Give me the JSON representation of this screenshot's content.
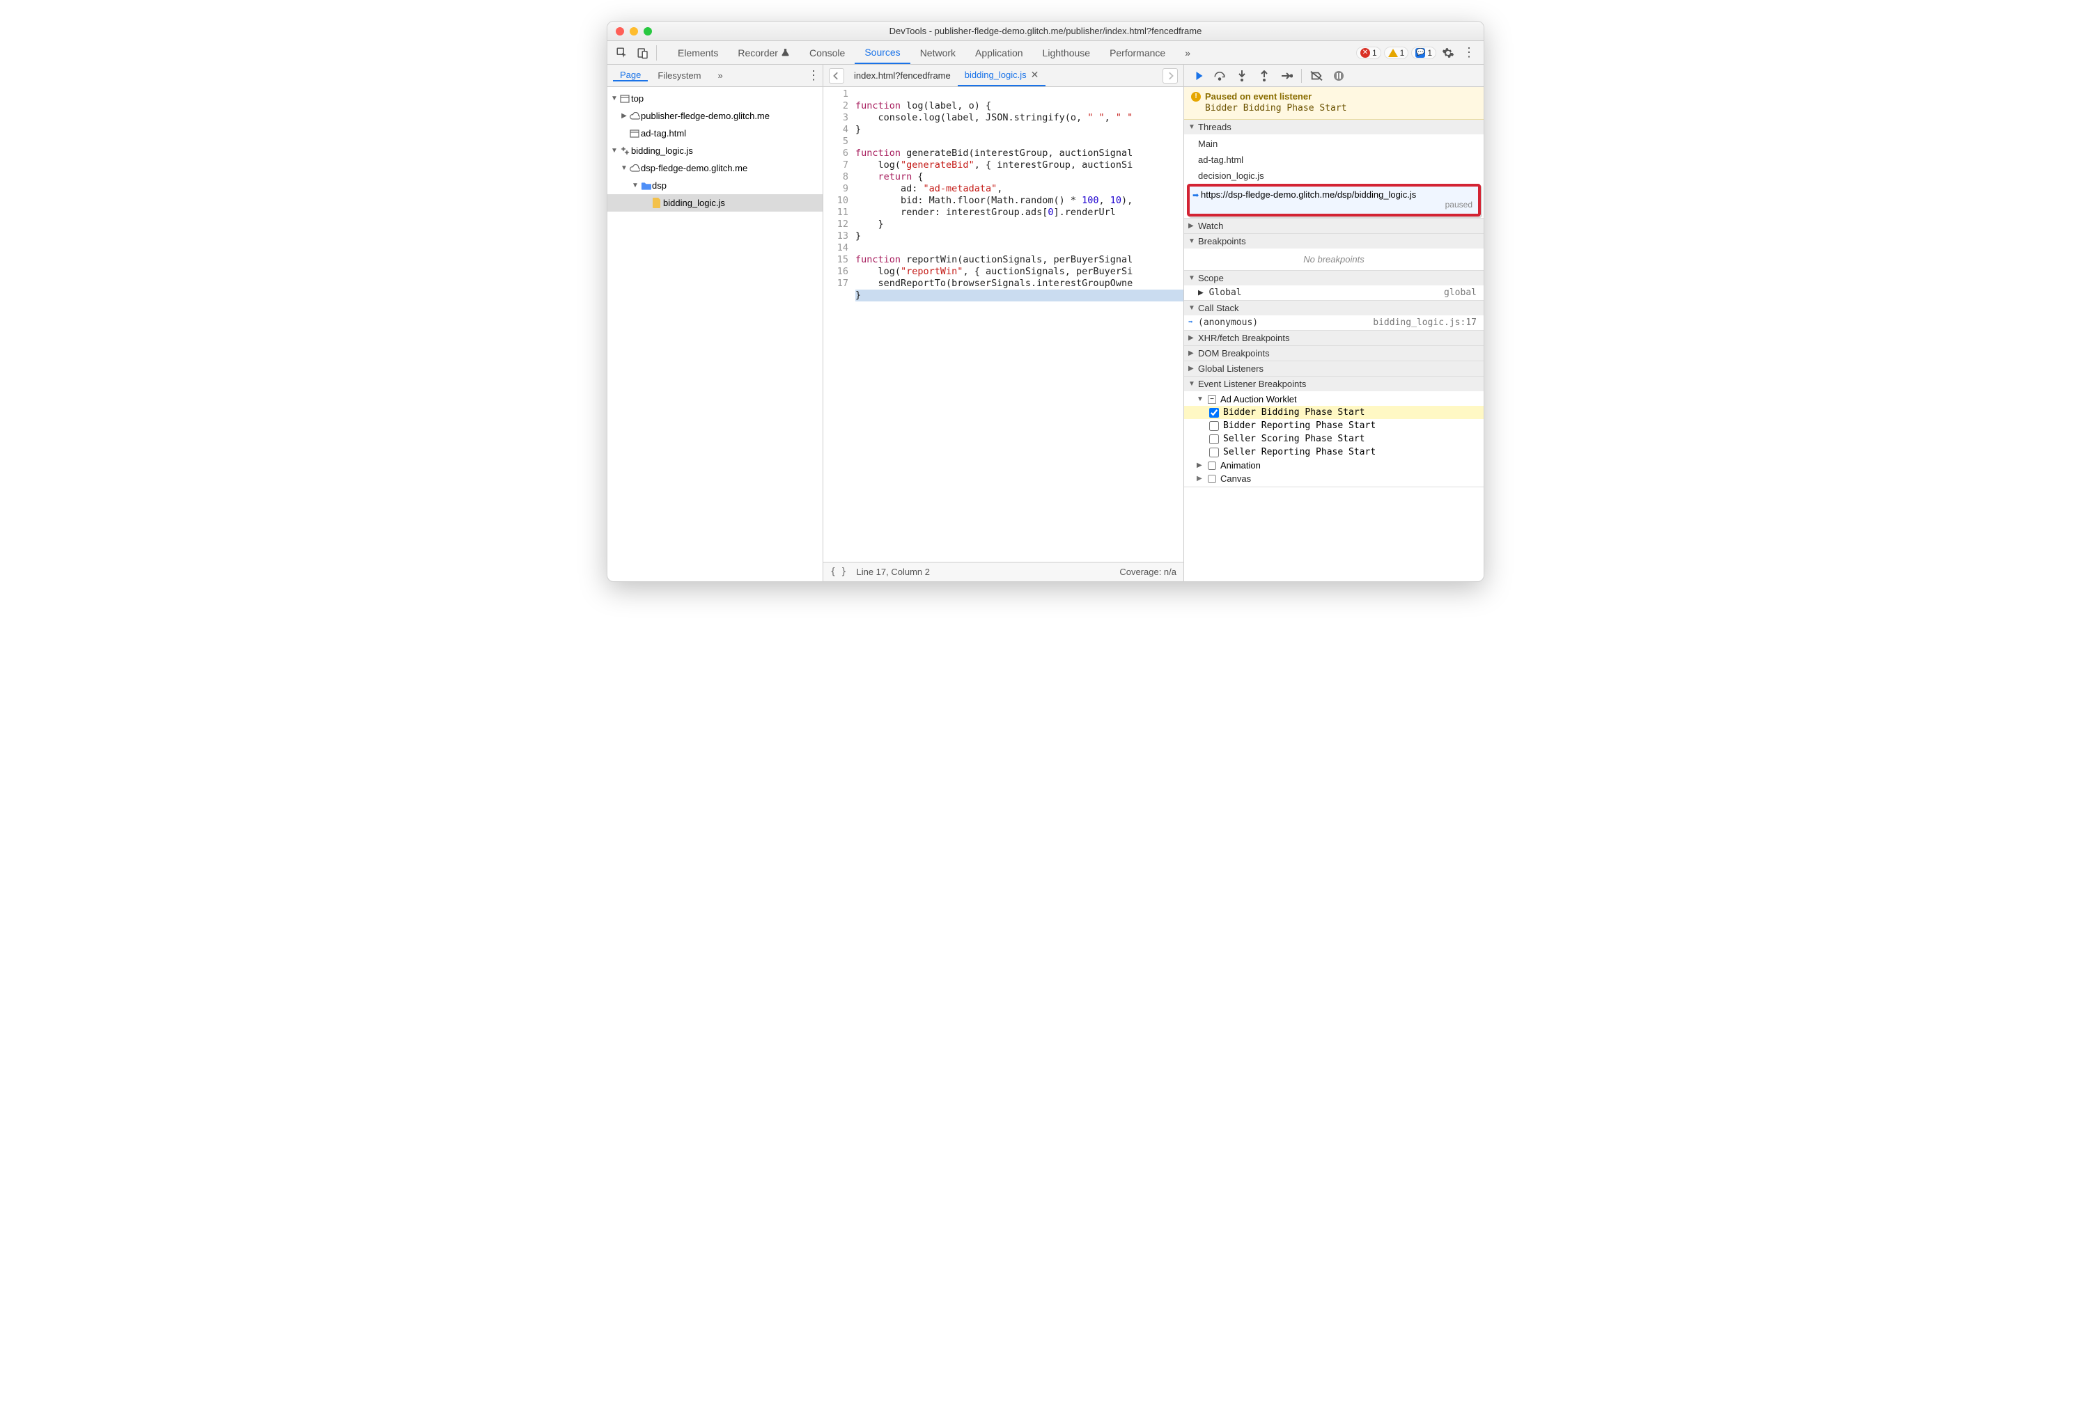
{
  "window": {
    "title": "DevTools - publisher-fledge-demo.glitch.me/publisher/index.html?fencedframe"
  },
  "panelTabs": {
    "items": [
      "Elements",
      "Recorder",
      "Console",
      "Sources",
      "Network",
      "Application",
      "Lighthouse",
      "Performance"
    ],
    "active": "Sources",
    "more": "»"
  },
  "badges": {
    "errors": "1",
    "warnings": "1",
    "issues": "1"
  },
  "sourcesSubTabs": {
    "items": [
      "Page",
      "Filesystem"
    ],
    "active": "Page",
    "more": "»"
  },
  "editor": {
    "openTabs": [
      {
        "label": "index.html?fencedframe"
      },
      {
        "label": "bidding_logic.js"
      }
    ],
    "activeTab": 1,
    "cursor": "Line 17, Column 2",
    "coverage": "Coverage: n/a",
    "lineCount": 17,
    "code": {
      "l1a": "function",
      "l1b": " log(label, o) {",
      "l2a": "    console.log(label, JSON.stringify(o, ",
      "l2s1": "\" \"",
      "l2b": ", ",
      "l2s2": "\" \"",
      "l3": "}",
      "l4": "",
      "l5a": "function",
      "l5b": " generateBid(interestGroup, auctionSignal",
      "l6a": "    log(",
      "l6s": "\"generateBid\"",
      "l6b": ", { interestGroup, auctionSi",
      "l7a": "    ",
      "l7k": "return",
      "l7b": " {",
      "l8a": "        ad: ",
      "l8s": "\"ad-metadata\"",
      "l8b": ",",
      "l9a": "        bid: Math.floor(Math.random() * ",
      "l9n1": "100",
      "l9b": ", ",
      "l9n2": "10",
      "l9c": "),",
      "l10a": "        render: interestGroup.ads[",
      "l10n": "0",
      "l10b": "].renderUrl",
      "l11": "    }",
      "l12": "}",
      "l13": "",
      "l14a": "function",
      "l14b": " reportWin(auctionSignals, perBuyerSignal",
      "l15a": "    log(",
      "l15s": "\"reportWin\"",
      "l15b": ", { auctionSignals, perBuyerSi",
      "l16": "    sendReportTo(browserSignals.interestGroupOwne",
      "l17": "}"
    }
  },
  "fileTree": {
    "items": [
      {
        "indent": 0,
        "toggle": "▼",
        "icon": "frame",
        "label": "top"
      },
      {
        "indent": 1,
        "toggle": "▶",
        "icon": "cloud",
        "label": "publisher-fledge-demo.glitch.me"
      },
      {
        "indent": 1,
        "toggle": "",
        "icon": "frame",
        "label": "ad-tag.html"
      },
      {
        "indent": 0,
        "toggle": "▼",
        "icon": "gears",
        "label": "bidding_logic.js"
      },
      {
        "indent": 1,
        "toggle": "▼",
        "icon": "cloud",
        "label": "dsp-fledge-demo.glitch.me"
      },
      {
        "indent": 2,
        "toggle": "▼",
        "icon": "folder",
        "label": "dsp"
      },
      {
        "indent": 3,
        "toggle": "",
        "icon": "jsfile",
        "label": "bidding_logic.js",
        "selected": true
      }
    ]
  },
  "pauseBanner": {
    "title": "Paused on event listener",
    "detail": "Bidder Bidding Phase Start"
  },
  "threads": {
    "title": "Threads",
    "items": [
      "Main",
      "ad-tag.html",
      "decision_logic.js"
    ],
    "highlighted": {
      "label": "https://dsp-fledge-demo.glitch.me/dsp/bidding_logic.js",
      "status": "paused"
    }
  },
  "watch": {
    "title": "Watch"
  },
  "breakpoints": {
    "title": "Breakpoints",
    "empty": "No breakpoints"
  },
  "scope": {
    "title": "Scope",
    "global": {
      "left": "Global",
      "right": "global"
    }
  },
  "callstack": {
    "title": "Call Stack",
    "frame": {
      "left": "(anonymous)",
      "right": "bidding_logic.js:17"
    }
  },
  "xhrBp": {
    "title": "XHR/fetch Breakpoints"
  },
  "domBp": {
    "title": "DOM Breakpoints"
  },
  "globalListeners": {
    "title": "Global Listeners"
  },
  "elb": {
    "title": "Event Listener Breakpoints",
    "adAuction": {
      "label": "Ad Auction Worklet",
      "items": [
        {
          "label": "Bidder Bidding Phase Start",
          "checked": true
        },
        {
          "label": "Bidder Reporting Phase Start",
          "checked": false
        },
        {
          "label": "Seller Scoring Phase Start",
          "checked": false
        },
        {
          "label": "Seller Reporting Phase Start",
          "checked": false
        }
      ]
    },
    "animation": {
      "label": "Animation"
    },
    "canvas": {
      "label": "Canvas"
    }
  }
}
